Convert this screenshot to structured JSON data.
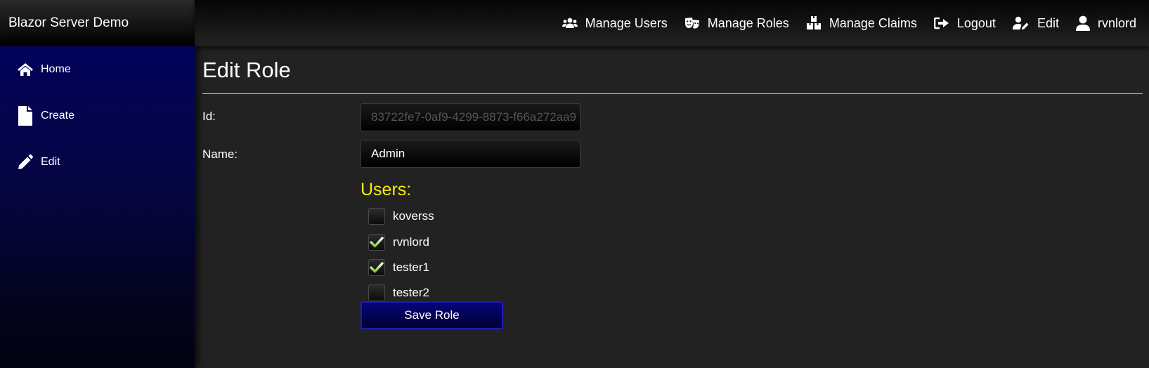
{
  "app": {
    "title": "Blazor Server Demo"
  },
  "topnav": {
    "manage_users": "Manage Users",
    "manage_roles": "Manage Roles",
    "manage_claims": "Manage Claims",
    "logout": "Logout",
    "edit": "Edit",
    "user": "rvnlord"
  },
  "sidebar": {
    "items": [
      {
        "label": "Home",
        "icon": "home-icon"
      },
      {
        "label": "Create",
        "icon": "file-icon"
      },
      {
        "label": "Edit",
        "icon": "pencil-icon"
      }
    ]
  },
  "page": {
    "title": "Edit Role",
    "id_label": "Id:",
    "id_value": "83722fe7-0af9-4299-8873-f66a272aa9",
    "name_label": "Name:",
    "name_value": "Admin",
    "users_heading": "Users:",
    "users": [
      {
        "name": "koverss",
        "checked": false
      },
      {
        "name": "rvnlord",
        "checked": true
      },
      {
        "name": "tester1",
        "checked": true
      },
      {
        "name": "tester2",
        "checked": false
      }
    ],
    "save_label": "Save Role"
  },
  "colors": {
    "accent_yellow": "#f5f000",
    "check_green": "#7ecb2a",
    "button_blue": "#05057a"
  }
}
